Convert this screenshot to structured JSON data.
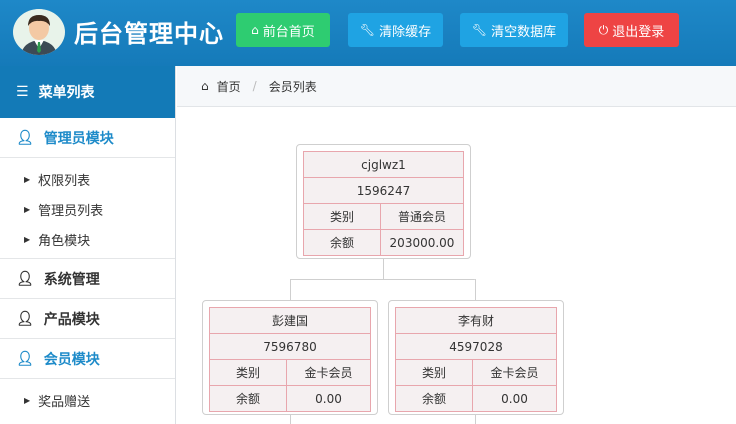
{
  "header": {
    "site_title": "后台管理中心",
    "buttons": [
      {
        "label": "前台首页",
        "icon": "home-icon",
        "color": "#2ecc71"
      },
      {
        "label": "清除缓存",
        "icon": "wrench-icon",
        "color": "#1fa3e3"
      },
      {
        "label": "清空数据库",
        "icon": "wrench-icon",
        "color": "#1fa3e3"
      },
      {
        "label": "退出登录",
        "icon": "power-icon",
        "color": "#ee4444"
      }
    ]
  },
  "sidebar": {
    "title": "菜单列表",
    "sections": [
      {
        "label": "管理员模块",
        "active": true,
        "items": [
          "权限列表",
          "管理员列表",
          "角色模块"
        ]
      },
      {
        "label": "系统管理",
        "active": false,
        "items": []
      },
      {
        "label": "产品模块",
        "active": false,
        "items": []
      },
      {
        "label": "会员模块",
        "active": true,
        "items": [
          "奖品赠送"
        ]
      }
    ]
  },
  "breadcrumb": {
    "home": "首页",
    "current": "会员列表"
  },
  "tree": {
    "root": {
      "name": "cjglwz1",
      "id": "1596247",
      "type_label": "类别",
      "type_value": "普通会员",
      "balance_label": "余额",
      "balance_value": "203000.00"
    },
    "children": [
      {
        "name": "彭建国",
        "id": "7596780",
        "type_label": "类别",
        "type_value": "金卡会员",
        "balance_label": "余额",
        "balance_value": "0.00"
      },
      {
        "name": "李有财",
        "id": "4597028",
        "type_label": "类别",
        "type_value": "金卡会员",
        "balance_label": "余额",
        "balance_value": "0.00"
      }
    ]
  }
}
